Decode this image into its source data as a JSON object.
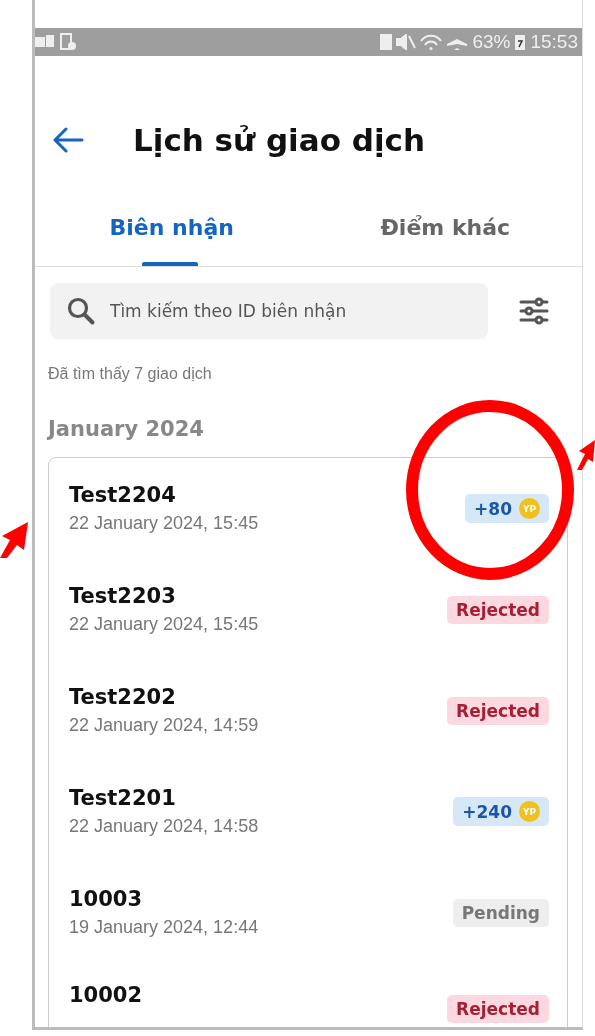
{
  "status_bar": {
    "battery": "63%",
    "time": "15:53"
  },
  "header": {
    "title": "Lịch sử giao dịch"
  },
  "tabs": [
    {
      "label": "Biên nhận",
      "selected": true
    },
    {
      "label": "Điểm khác",
      "selected": false
    }
  ],
  "search": {
    "placeholder": "Tìm kiếm theo ID biên nhận"
  },
  "result_count": "Đã tìm thấy 7 giao dịch",
  "month": "January 2024",
  "transactions": [
    {
      "id": "Test2204",
      "date": "22 January 2024, 15:45",
      "badge": {
        "kind": "points",
        "text": "+80",
        "coin": "YP"
      }
    },
    {
      "id": "Test2203",
      "date": "22 January 2024, 15:45",
      "badge": {
        "kind": "rejected",
        "text": "Rejected"
      }
    },
    {
      "id": "Test2202",
      "date": "22 January 2024, 14:59",
      "badge": {
        "kind": "rejected",
        "text": "Rejected"
      }
    },
    {
      "id": "Test2201",
      "date": "22 January 2024, 14:58",
      "badge": {
        "kind": "points",
        "text": "+240",
        "coin": "YP"
      }
    },
    {
      "id": "10003",
      "date": "19 January 2024, 12:44",
      "badge": {
        "kind": "pending",
        "text": "Pending"
      }
    },
    {
      "id": "10002",
      "badge": {
        "kind": "rejected",
        "text": "Rejected"
      }
    }
  ]
}
